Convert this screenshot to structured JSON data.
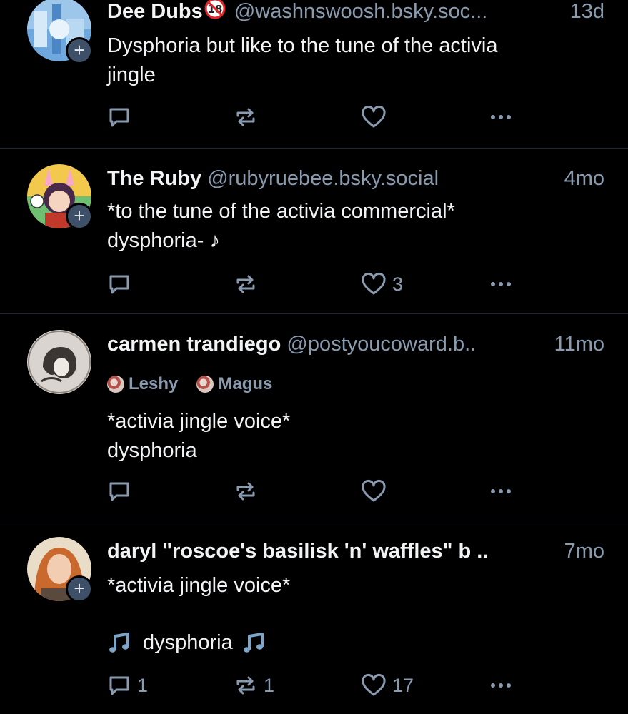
{
  "colors": {
    "background": "#000000",
    "text": "#f1f3f5",
    "muted": "#8a9bb0",
    "divider": "#1f2833"
  },
  "posts": [
    {
      "name": "Dee Dubs",
      "badge_icon": "adult-content-18-icon",
      "handle": "@washnswoosh.bsky.soc...",
      "time": "13d",
      "text": "Dysphoria but like to the tune of the activia\njingle",
      "replies": "",
      "reposts": "",
      "likes": "",
      "follow_badge": "+"
    },
    {
      "name": "The Ruby",
      "handle": "@rubyruebee.bsky.social",
      "time": "4mo",
      "text": "*to the tune of the activia commercial*\ndysphoria- ♪",
      "replies": "",
      "reposts": "",
      "likes": "3",
      "follow_badge": "+"
    },
    {
      "name": "carmen trandiego",
      "handle": "@postyoucoward.b..",
      "time": "11mo",
      "labels": [
        "Leshy",
        "Magus"
      ],
      "text": "*activia jingle voice*\ndysphoria",
      "replies": "",
      "reposts": "",
      "likes": ""
    },
    {
      "name": "daryl \"roscoe's basilisk 'n' waffles\" b ..",
      "handle": "",
      "time": "7mo",
      "text": "*activia jingle voice*",
      "text2": "dysphoria",
      "replies": "1",
      "reposts": "1",
      "likes": "17",
      "follow_badge": "+"
    }
  ]
}
